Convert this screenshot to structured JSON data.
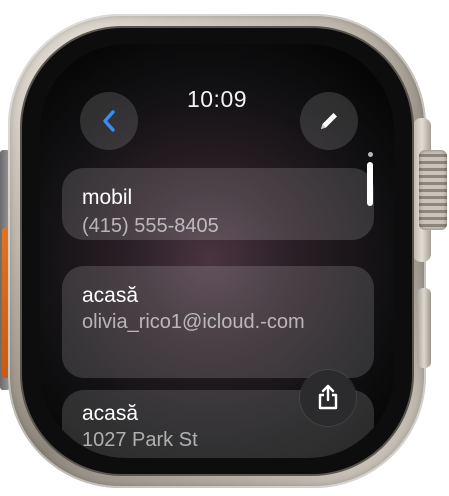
{
  "status": {
    "time": "10:09"
  },
  "nav": {
    "back_icon": "chevron-left-icon",
    "edit_icon": "pencil-icon",
    "accent_color": "#3a8df5"
  },
  "contact_fields": [
    {
      "label": "mobil",
      "value": "(415) 555-8405"
    },
    {
      "label": "acasă",
      "value": "olivia_rico1@icloud.-com"
    },
    {
      "label": "acasă",
      "value": "1027 Park St"
    }
  ],
  "actions": {
    "share_icon": "share-icon"
  }
}
